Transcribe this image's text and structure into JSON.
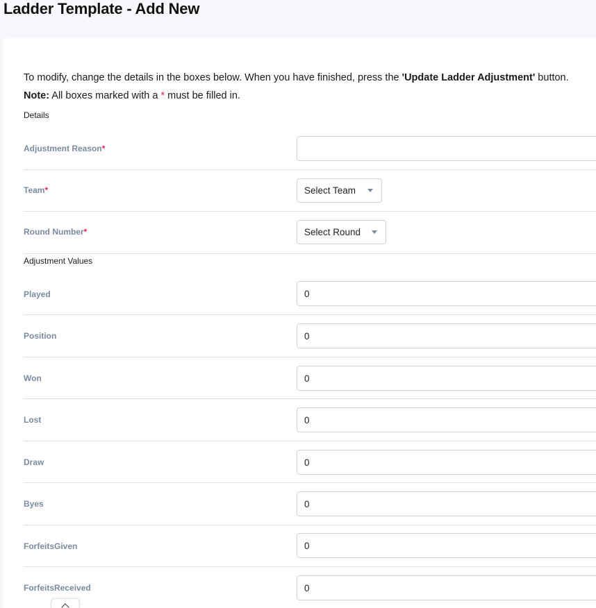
{
  "page": {
    "title": "Ladder Template - Add New"
  },
  "intro": {
    "line1_prefix": "To modify, change the details in the boxes below. When you have finished, press the ",
    "line1_button_name": "'Update Ladder Adjustment'",
    "line1_suffix": " button.",
    "note_label": "Note:",
    "note_text_prefix": " All boxes marked with a ",
    "required_marker": "*",
    "note_text_suffix": " must be filled in."
  },
  "sections": {
    "details": "Details",
    "adjustment_values": "Adjustment Values"
  },
  "details_fields": {
    "adjustment_reason": {
      "label": "Adjustment Reason",
      "value": ""
    },
    "team": {
      "label": "Team",
      "selected": "Select Team"
    },
    "round_number": {
      "label": "Round Number",
      "selected": "Select Round"
    }
  },
  "adjustment_fields": [
    {
      "label": "Played",
      "value": "0"
    },
    {
      "label": "Position",
      "value": "0"
    },
    {
      "label": "Won",
      "value": "0"
    },
    {
      "label": "Lost",
      "value": "0"
    },
    {
      "label": "Draw",
      "value": "0"
    },
    {
      "label": "Byes",
      "value": "0"
    },
    {
      "label": "ForfeitsGiven",
      "value": "0"
    },
    {
      "label": "ForfeitsReceived",
      "value": "0"
    }
  ],
  "icons": {
    "select_caret": "caret-down-icon",
    "scroll_up": "chevron-up-icon"
  },
  "colors": {
    "required": "#e0245e",
    "label": "#7a8aa0",
    "page_background": "#f6f8fb"
  }
}
